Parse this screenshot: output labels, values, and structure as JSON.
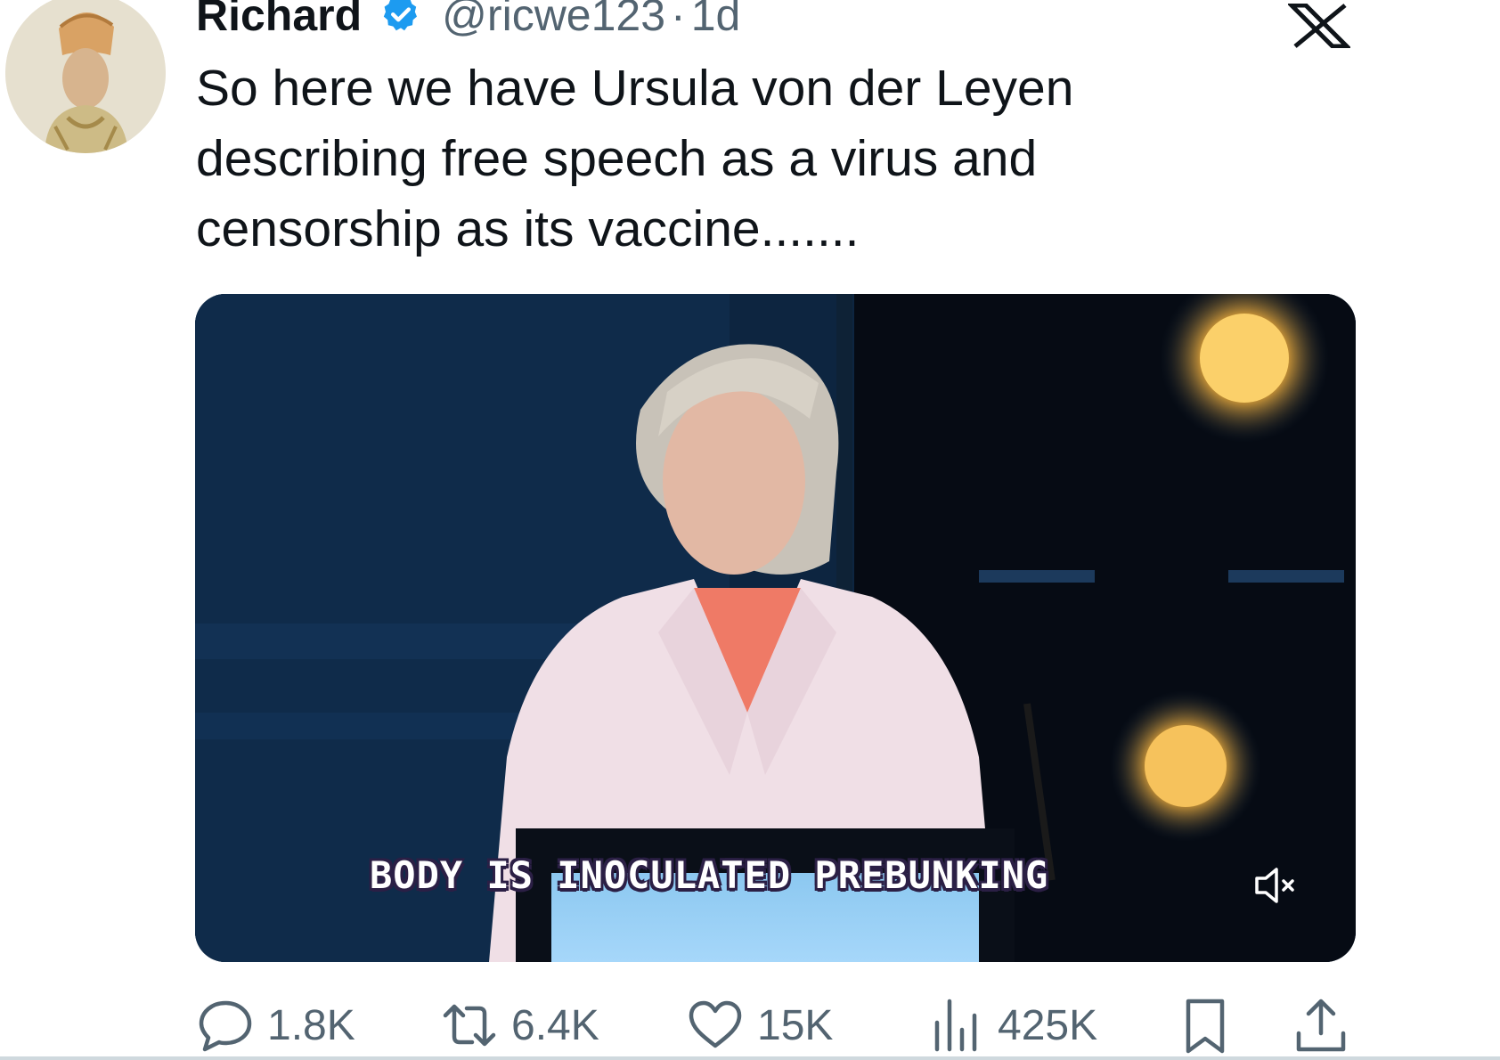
{
  "tweet": {
    "display_name": "Richard",
    "handle": "@ricwe123",
    "separator": "·",
    "time": "1d",
    "text_lines": [
      "So here we have Ursula von der Leyen",
      "describing free speech as a virus and",
      "censorship as its vaccine......."
    ]
  },
  "media": {
    "type": "video",
    "caption": "BODY IS INOCULATED PREBUNKING",
    "muted": true
  },
  "actions": {
    "replies": "1.8K",
    "reposts": "6.4K",
    "likes": "15K",
    "views": "425K"
  },
  "icons": [
    "avatar",
    "verified-badge-icon",
    "x-logo-icon",
    "mute-icon",
    "reply-icon",
    "repost-icon",
    "like-icon",
    "views-icon",
    "bookmark-icon",
    "share-icon"
  ],
  "colors": {
    "text": "#0f1419",
    "secondary_text": "#536471",
    "verified_blue": "#1d9bf0",
    "caption_outline": "#2b1f45"
  }
}
